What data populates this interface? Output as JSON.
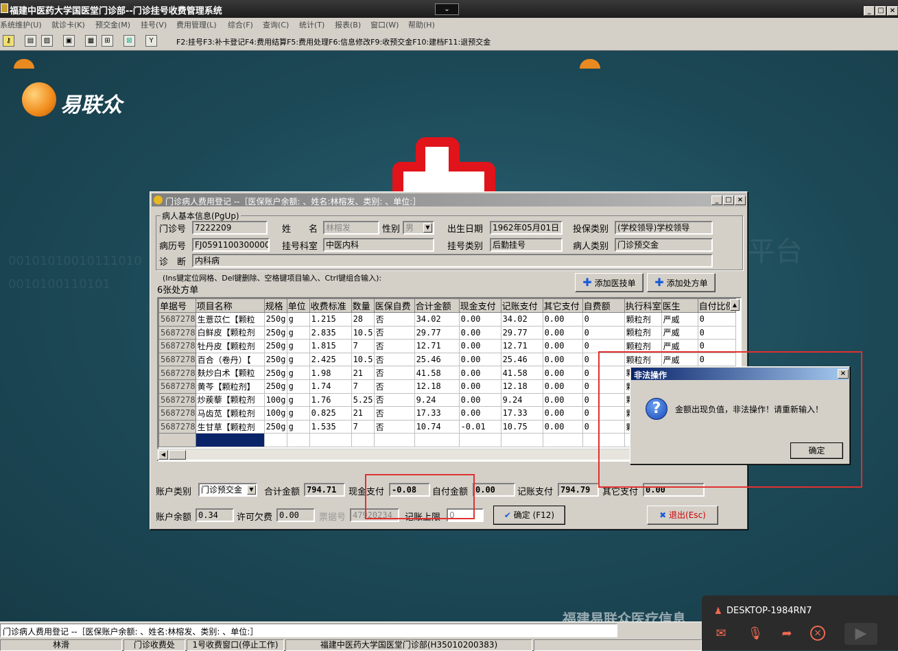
{
  "app_title": "福建中医药大学国医堂门诊部--门诊挂号收费管理系统",
  "menu": [
    "系统维护(U)",
    "就诊卡(K)",
    "预交金(M)",
    "挂号(V)",
    "费用管理(L)",
    "综合(F)",
    "查询(C)",
    "统计(T)",
    "报表(B)",
    "窗口(W)",
    "帮助(H)"
  ],
  "toolbar": {
    "hotkeys": "F2:挂号F3:补卡登记F4:费用结算F5:费用处理F6:信息修改F9:收预交金F10:建档F11:退预交金"
  },
  "desktop": {
    "logo_text": "易联众",
    "company_text": "福建易联众医疗信息"
  },
  "window": {
    "title": "门诊病人费用登记 --［医保账户余额: 、姓名:林榕发、类别: 、单位:］",
    "group_title": "病人基本信息(PgUp)",
    "labels": {
      "clinic_no": "门诊号",
      "name": "姓　　名",
      "sex": "性别",
      "birth": "出生日期",
      "insure": "投保类别",
      "record_no": "病历号",
      "dept": "挂号科室",
      "reg_type": "挂号类别",
      "patient_type": "病人类别",
      "diagnosis": "诊　断"
    },
    "values": {
      "clinic_no": "7222209",
      "name": "林榕发",
      "sex": "男",
      "birth": "1962年05月01日",
      "insure": "(学校领导)学校领导",
      "record_no": "FJ0591100300000C",
      "dept": "中医内科",
      "reg_type": "后勤挂号",
      "patient_type": "门诊预交金",
      "diagnosis": "内科病"
    },
    "hint": "(Ins键定位网格、Del键删除、空格键项目输入、Ctrl键组合输入):",
    "prescription_count": "6张处方单",
    "add_tech_button": "添加医技单",
    "add_rx_button": "添加处方单"
  },
  "table": {
    "headers": [
      "单据号",
      "项目名称",
      "规格",
      "单位",
      "收费标准",
      "数量",
      "医保自费",
      "合计金额",
      "现金支付",
      "记账支付",
      "其它支付",
      "自费额",
      "执行科室",
      "医生",
      "自付比例"
    ],
    "rows": [
      [
        "5687278",
        "生薏苡仁【颗粒",
        "250g",
        "g",
        "1.215",
        "28",
        "否",
        "34.02",
        "0.00",
        "34.02",
        "0.00",
        "0",
        "颗粒剂",
        "严威",
        "0"
      ],
      [
        "5687278",
        "白鲜皮【颗粒剂",
        "250g",
        "g",
        "2.835",
        "10.5",
        "否",
        "29.77",
        "0.00",
        "29.77",
        "0.00",
        "0",
        "颗粒剂",
        "严威",
        "0"
      ],
      [
        "5687278",
        "牡丹皮【颗粒剂",
        "250g",
        "g",
        "1.815",
        "7",
        "否",
        "12.71",
        "0.00",
        "12.71",
        "0.00",
        "0",
        "颗粒剂",
        "严威",
        "0"
      ],
      [
        "5687278",
        "百合（卷丹）【",
        "250g",
        "g",
        "2.425",
        "10.5",
        "否",
        "25.46",
        "0.00",
        "25.46",
        "0.00",
        "0",
        "颗粒剂",
        "严威",
        "0"
      ],
      [
        "5687278",
        "麸炒白术【颗粒",
        "250g",
        "g",
        "1.98",
        "21",
        "否",
        "41.58",
        "0.00",
        "41.58",
        "0.00",
        "0",
        "颗",
        "",
        ""
      ],
      [
        "5687278",
        "黄芩【颗粒剂】",
        "250g",
        "g",
        "1.74",
        "7",
        "否",
        "12.18",
        "0.00",
        "12.18",
        "0.00",
        "0",
        "颗",
        "",
        ""
      ],
      [
        "5687278",
        "炒蒺藜【颗粒剂",
        "100g",
        "g",
        "1.76",
        "5.25",
        "否",
        "9.24",
        "0.00",
        "9.24",
        "0.00",
        "0",
        "颗",
        "",
        ""
      ],
      [
        "5687278",
        "马齿苋【颗粒剂",
        "100g",
        "g",
        "0.825",
        "21",
        "否",
        "17.33",
        "0.00",
        "17.33",
        "0.00",
        "0",
        "颗",
        "",
        ""
      ],
      [
        "5687278",
        "生甘草【颗粒剂",
        "250g",
        "g",
        "1.535",
        "7",
        "否",
        "10.74",
        "-0.01",
        "10.75",
        "0.00",
        "0",
        "颗",
        "",
        ""
      ]
    ]
  },
  "summary": {
    "account_type_label": "账户类别",
    "account_type": "门诊预交金",
    "total_label": "合计金额",
    "total": "794.71",
    "cash_label": "现金支付",
    "cash": "-0.08",
    "self_label": "自付金额",
    "self": "0.00",
    "charge_label": "记账支付",
    "charge": "794.79",
    "other_label": "其它支付",
    "other": "0.00",
    "balance_label": "账户余额",
    "balance": "0.34",
    "overdraft_label": "许可欠费",
    "overdraft": "0.00",
    "receipt_label": "票据号",
    "receipt": "47920234",
    "limit_label": "记账上限",
    "limit": "0",
    "confirm_button": "确定 (F12)",
    "exit_button": "退出(Esc)"
  },
  "dialog": {
    "title": "非法操作",
    "message": "金额出现负值，非法操作！请重新输入！",
    "ok": "确定"
  },
  "status": {
    "line1": "门诊病人费用登记 --［医保账户余额: 、姓名:林榕发、类别: 、单位:］",
    "user": "林滑",
    "dept": "门诊收费处",
    "window": "1号收费窗口(停止工作)",
    "org": "福建中医药大学国医堂门诊部(H35010200383)"
  },
  "remote": {
    "host": "DESKTOP-1984RN7"
  }
}
